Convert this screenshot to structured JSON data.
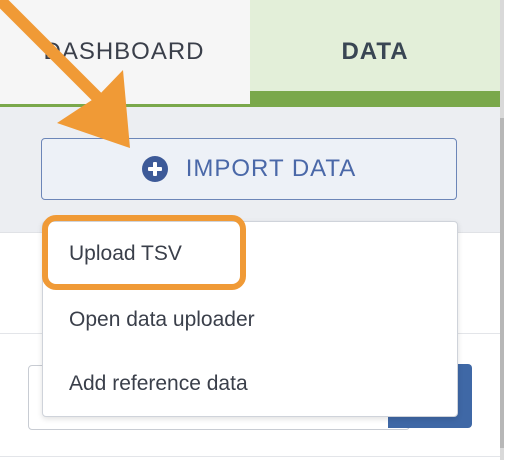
{
  "tabs": {
    "dashboard_label": "DASHBOARD",
    "data_label": "DATA"
  },
  "toolbar": {
    "import_label": "IMPORT DATA"
  },
  "import_menu": {
    "items": [
      {
        "label": "Upload TSV"
      },
      {
        "label": "Open data uploader"
      },
      {
        "label": "Add reference data"
      }
    ]
  },
  "colors": {
    "accent_green": "#7aa84b",
    "active_tab_bg": "#e3efd9",
    "import_blue": "#4a68a8",
    "annotation_orange": "#f09a36"
  },
  "icons": {
    "import": "plus-circle-icon"
  }
}
